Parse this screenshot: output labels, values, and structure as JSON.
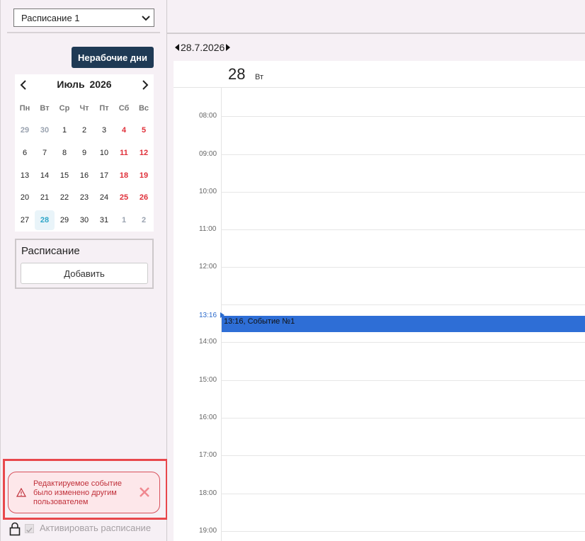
{
  "sidebar": {
    "schedule_select": "Расписание 1",
    "nonwork_days_label": "Нерабочие дни",
    "calendar": {
      "month_label": "Июль  2026",
      "weekdays": [
        "Пн",
        "Вт",
        "Ср",
        "Чт",
        "Пт",
        "Сб",
        "Вс"
      ],
      "weeks": [
        [
          "29",
          "30",
          "1",
          "2",
          "3",
          "4",
          "5"
        ],
        [
          "6",
          "7",
          "8",
          "9",
          "10",
          "11",
          "12"
        ],
        [
          "13",
          "14",
          "15",
          "16",
          "17",
          "18",
          "19"
        ],
        [
          "20",
          "21",
          "22",
          "23",
          "24",
          "25",
          "26"
        ],
        [
          "27",
          "28",
          "29",
          "30",
          "31",
          "1",
          "2"
        ]
      ],
      "today": "28"
    },
    "schedule_section": {
      "title": "Расписание",
      "add_label": "Добавить"
    },
    "toast_message": "Редактируемое событие было изменено другим пользователем",
    "activate_label": "Активировать расписание"
  },
  "main": {
    "date_label": "28.7.2026",
    "day_number": "28",
    "day_weekday": "Вт",
    "time_labels": [
      "08:00",
      "09:00",
      "10:00",
      "11:00",
      "12:00",
      "13:16",
      "14:00",
      "15:00",
      "16:00",
      "17:00",
      "18:00",
      "19:00"
    ],
    "event_label": "13:16, Событие №1"
  },
  "colors": {
    "accent": "#2e6ed6",
    "weekend": "#e0303a",
    "today": "#2fa6c8",
    "button_dark": "#1f3a55",
    "toast_border": "#d8505a"
  }
}
